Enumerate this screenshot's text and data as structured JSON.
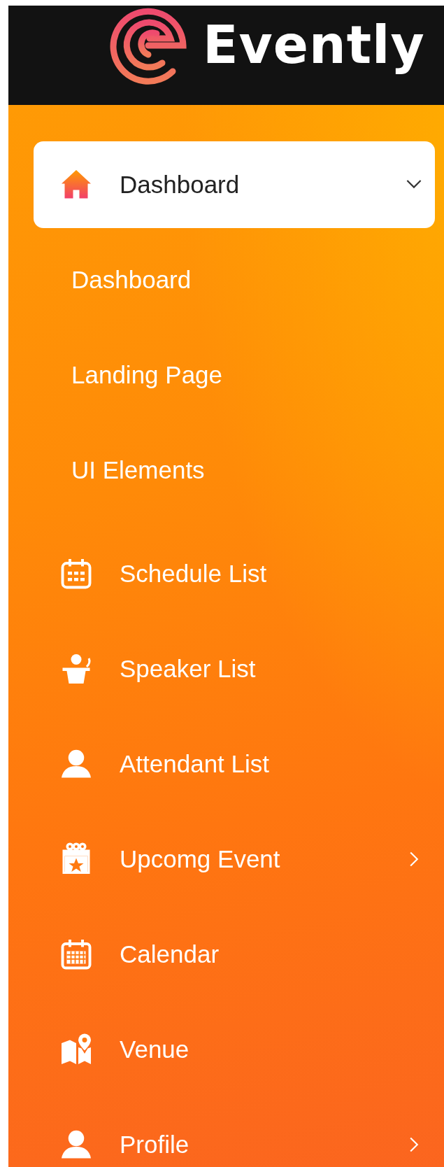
{
  "brand": {
    "name": "Evently"
  },
  "menu": [
    {
      "label": "Dashboard",
      "expanded": true,
      "children": [
        {
          "label": "Dashboard"
        },
        {
          "label": "Landing Page"
        },
        {
          "label": "UI Elements"
        }
      ]
    },
    {
      "label": "Schedule List"
    },
    {
      "label": "Speaker List"
    },
    {
      "label": "Attendant List"
    },
    {
      "label": "Upcomg Event",
      "expanded": false
    },
    {
      "label": "Calendar"
    },
    {
      "label": "Venue"
    },
    {
      "label": "Profile",
      "expanded": false
    }
  ]
}
